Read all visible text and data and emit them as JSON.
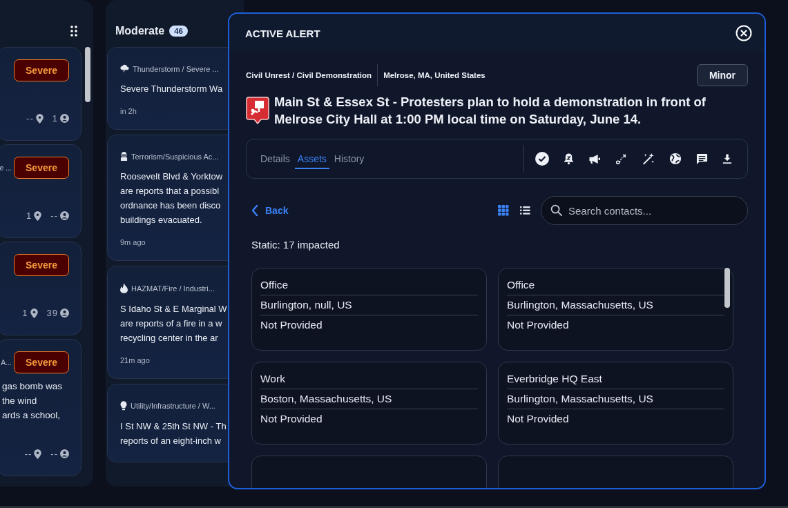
{
  "left_column": {
    "cards": [
      {
        "badge": "Severe",
        "locations": "--",
        "people": "1"
      },
      {
        "category": "e ...",
        "badge": "Severe",
        "locations": "1",
        "people": "--"
      },
      {
        "badge": "Severe",
        "locations": "1",
        "people": "39"
      },
      {
        "category": "A...",
        "badge": "Severe",
        "lines": [
          "gas bomb was",
          "the wind",
          "ards a school,"
        ],
        "locations": "--",
        "people": "--"
      }
    ]
  },
  "moderate_column": {
    "title": "Moderate",
    "count": "46",
    "cards": [
      {
        "kind": "storm",
        "category": "Thunderstorm / Severe ...",
        "lines": [
          "Severe Thunderstorm Wa"
        ],
        "time": "in 2h"
      },
      {
        "kind": "hooded",
        "category": "Terrorism/Suspicious Ac...",
        "lines": [
          "Roosevelt Blvd & Yorktow",
          "are reports that a possibl",
          "ordnance has been disco",
          "buildings evacuated."
        ],
        "time": "9m ago"
      },
      {
        "kind": "flame",
        "category": "HAZMAT/Fire / Industri...",
        "lines": [
          "S Idaho St & E Marginal W",
          "are reports of a fire in a w",
          "recycling center in the ar"
        ],
        "time": "21m ago"
      },
      {
        "kind": "bulb",
        "category": "Utility/Infrastructure / W...",
        "lines": [
          "I St NW & 25th St NW - Th",
          "reports of an eight-inch w"
        ]
      }
    ]
  },
  "alert": {
    "title": "ACTIVE ALERT",
    "category": "Civil Unrest / Civil Demonstration",
    "location": "Melrose, MA, United States",
    "severity": "Minor",
    "headline": "Main St & Essex St - Protesters plan to hold a demonstration in front of Melrose City Hall at 1:00 PM local time on Saturday, June 14.",
    "tabs": [
      {
        "label": "Details",
        "selected": false
      },
      {
        "label": "Assets",
        "selected": true
      },
      {
        "label": "History",
        "selected": false
      }
    ],
    "actions": [
      {
        "kind": "check"
      },
      {
        "kind": "snooze"
      },
      {
        "kind": "megaphone"
      },
      {
        "kind": "route"
      },
      {
        "kind": "wand"
      },
      {
        "kind": "globe"
      },
      {
        "kind": "chat"
      },
      {
        "kind": "download"
      }
    ],
    "back": "Back",
    "view_modes": [
      {
        "kind": "grid",
        "selected": true
      },
      {
        "kind": "list",
        "selected": false
      }
    ],
    "search": {
      "placeholder": "Search contacts..."
    },
    "summary": "Static: 17 impacted",
    "contacts": [
      {
        "name": "Office",
        "address": "Burlington, null, US",
        "phone": "Not Provided"
      },
      {
        "name": "Office",
        "address": "Burlington, Massachusetts, US",
        "phone": "Not Provided"
      },
      {
        "name": "Work",
        "address": "Boston, Massachusetts, US",
        "phone": "Not Provided"
      },
      {
        "name": "Everbridge HQ East",
        "address": "Burlington, Massachusetts, US",
        "phone": "Not Provided"
      }
    ]
  }
}
